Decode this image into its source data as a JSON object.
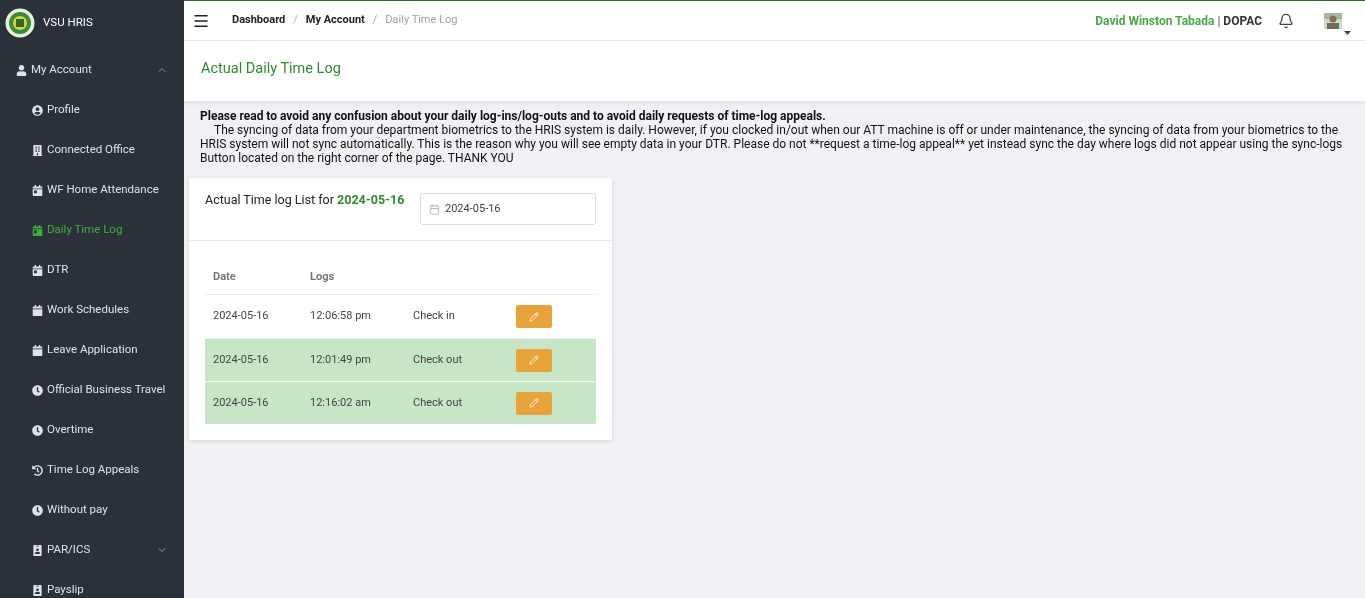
{
  "app": {
    "name": "VSU HRIS"
  },
  "sidebar": {
    "items": [
      {
        "label": "My Account",
        "kind": "user",
        "selected": false,
        "expanded": true,
        "children": [
          {
            "label": "Profile",
            "kind": "profile",
            "selected": false
          },
          {
            "label": "Connected Office",
            "kind": "office",
            "selected": false
          },
          {
            "label": "WF Home Attendance",
            "kind": "day",
            "selected": false
          },
          {
            "label": "Daily Time Log",
            "kind": "day",
            "selected": true
          },
          {
            "label": "DTR",
            "kind": "day",
            "selected": false
          },
          {
            "label": "Work Schedules",
            "kind": "schedule",
            "selected": false
          },
          {
            "label": "Leave Application",
            "kind": "schedule",
            "selected": false
          },
          {
            "label": "Official Business Travel",
            "kind": "time",
            "selected": false
          },
          {
            "label": "Overtime",
            "kind": "time",
            "selected": false
          },
          {
            "label": "Time Log Appeals",
            "kind": "appeal",
            "selected": false
          },
          {
            "label": "Without pay",
            "kind": "time",
            "selected": false
          },
          {
            "label": "PAR/ICS",
            "kind": "record",
            "selected": false,
            "expanded": false
          },
          {
            "label": "Payslip",
            "kind": "record",
            "selected": false
          }
        ]
      }
    ]
  },
  "header": {
    "breadcrumbs": [
      {
        "label": "Dashboard",
        "selected": false
      },
      {
        "label": "My Account",
        "selected": false
      },
      {
        "label": "Daily Time Log",
        "selected": true
      }
    ],
    "separator": "/",
    "user_name": "David Winston Tabada",
    "user_sep": "|",
    "office": "DOPAC"
  },
  "page_title": "Actual Daily Time Log",
  "notice": {
    "heading": "Please read to avoid any confusion about your daily log-ins/log-outs and to avoid daily requests of time-log appeals.",
    "body": "The syncing of data from your department biometrics to the HRIS system is daily. However, if you clocked in/out when our ATT machine is off or under maintenance, the syncing of data from your biometrics to the HRIS system will not sync automatically. This is the reason why you will see empty data in your DTR. Please do not **request a time-log appeal** yet instead sync the day where logs did not appear using the sync-logs Button located on the right corner of the page. THANK YOU"
  },
  "card": {
    "title": "Actual Time log List for",
    "title_date": "2024-05-16",
    "date_field": {
      "value": "2024-05-16"
    },
    "table": {
      "columns": [
        "Date",
        "Logs"
      ],
      "rows": [
        {
          "date": "2024-05-16",
          "time": "12:06:58 pm",
          "type": "Check in",
          "highlighted": false
        },
        {
          "date": "2024-05-16",
          "time": "12:01:49 pm",
          "type": "Check out",
          "highlighted": true
        },
        {
          "date": "2024-05-16",
          "time": "12:16:02 am",
          "type": "Check out",
          "highlighted": true
        }
      ]
    }
  }
}
